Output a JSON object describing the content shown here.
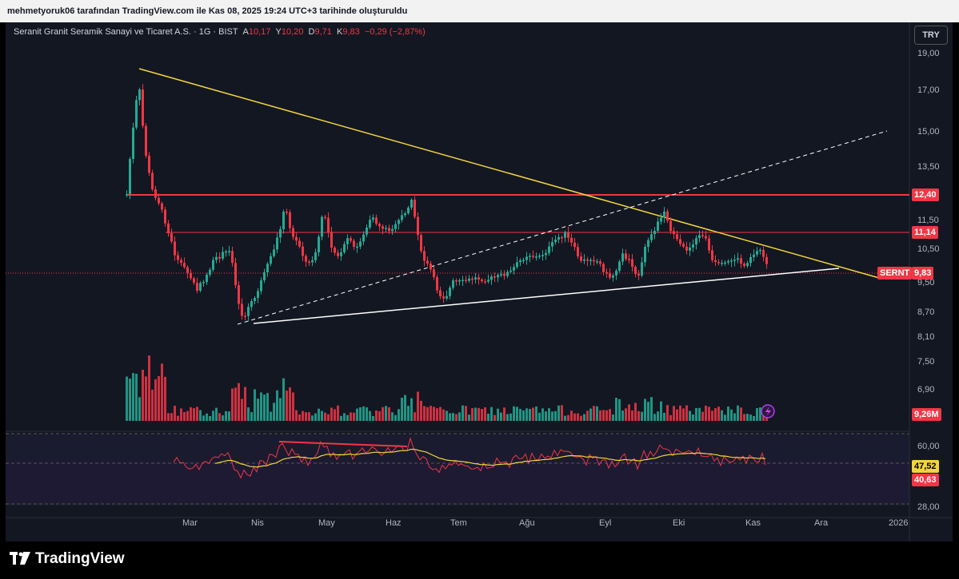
{
  "header": {
    "attribution": "mehmetyoruk06 tarafından TradingView.com ile Kas 08, 2025 19:24 UTC+3 tarihinde oluşturuldu"
  },
  "legend": {
    "symbol": "Seranit Granit Seramik Sanayi ve Ticaret A.S. · 1G · BIST",
    "a_label": "A",
    "a_value": "10,17",
    "y_label": "Y",
    "y_value": "10,20",
    "d_label": "D",
    "d_value": "9,71",
    "k_label": "K",
    "k_value": "9,83",
    "change": "−0,29 (−2,87%)"
  },
  "currency_button": "TRY",
  "price_axis": [
    "19,00",
    "17,00",
    "15,00",
    "13,50",
    "11,50",
    "10,50",
    "9,50",
    "8,70",
    "8,10",
    "7,50",
    "6,90"
  ],
  "rsi_axis": [
    "60,00",
    "28,00"
  ],
  "price_tags": {
    "res1": "12,40",
    "res2": "11,14",
    "symbol": "SERNT",
    "last": "9,83",
    "volume": "9,26M",
    "rsi": "47,52",
    "rsi_ma": "40,63"
  },
  "time_axis": [
    "Mar",
    "Nis",
    "May",
    "Haz",
    "Tem",
    "Ağu",
    "Eyl",
    "Eki",
    "Kas",
    "Ara",
    "2026"
  ],
  "colors": {
    "up": "#22ab94",
    "down": "#f23645",
    "yellow": "#f2d53c",
    "resistance": "#f23645",
    "rsi": "#f23645",
    "rsi_ma": "#f2d53c"
  },
  "footer": {
    "brand": "TradingView",
    "logo_icon": "tradingview-logo-icon"
  }
}
